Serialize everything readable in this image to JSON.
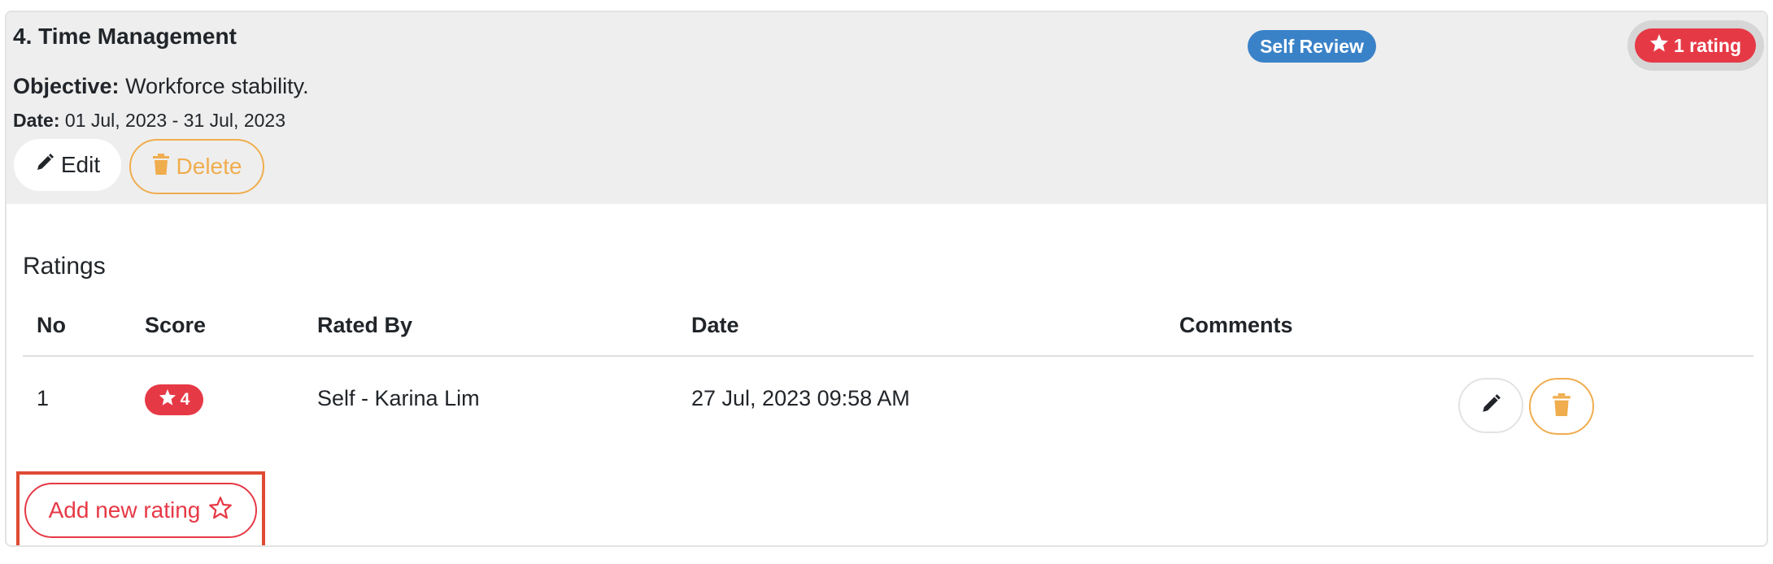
{
  "objective_card": {
    "title": "4. Time Management",
    "objective_label": "Objective:",
    "objective_text": "Workforce stability.",
    "date_label": "Date:",
    "date_text": "01 Jul, 2023 - 31 Jul, 2023",
    "edit_label": "Edit",
    "delete_label": "Delete",
    "review_type_badge": "Self Review",
    "rating_count_badge": "1 rating"
  },
  "ratings": {
    "heading": "Ratings",
    "columns": [
      "No",
      "Score",
      "Rated By",
      "Date",
      "Comments"
    ],
    "rows": [
      {
        "no": "1",
        "score": "4",
        "rated_by": "Self - Karina Lim",
        "date": "27 Jul, 2023 09:58 AM",
        "comments": ""
      }
    ],
    "add_button_label": "Add new rating"
  },
  "icons": {
    "edit": "pencil-icon",
    "delete": "trash-icon",
    "star_filled": "star-icon",
    "star_outline": "star-outline-icon"
  },
  "colors": {
    "primary_badge": "#3a82c8",
    "danger": "#e63946",
    "warning": "#f0ad4e",
    "highlight": "#e04a33",
    "header_bg": "#eeeeee"
  }
}
